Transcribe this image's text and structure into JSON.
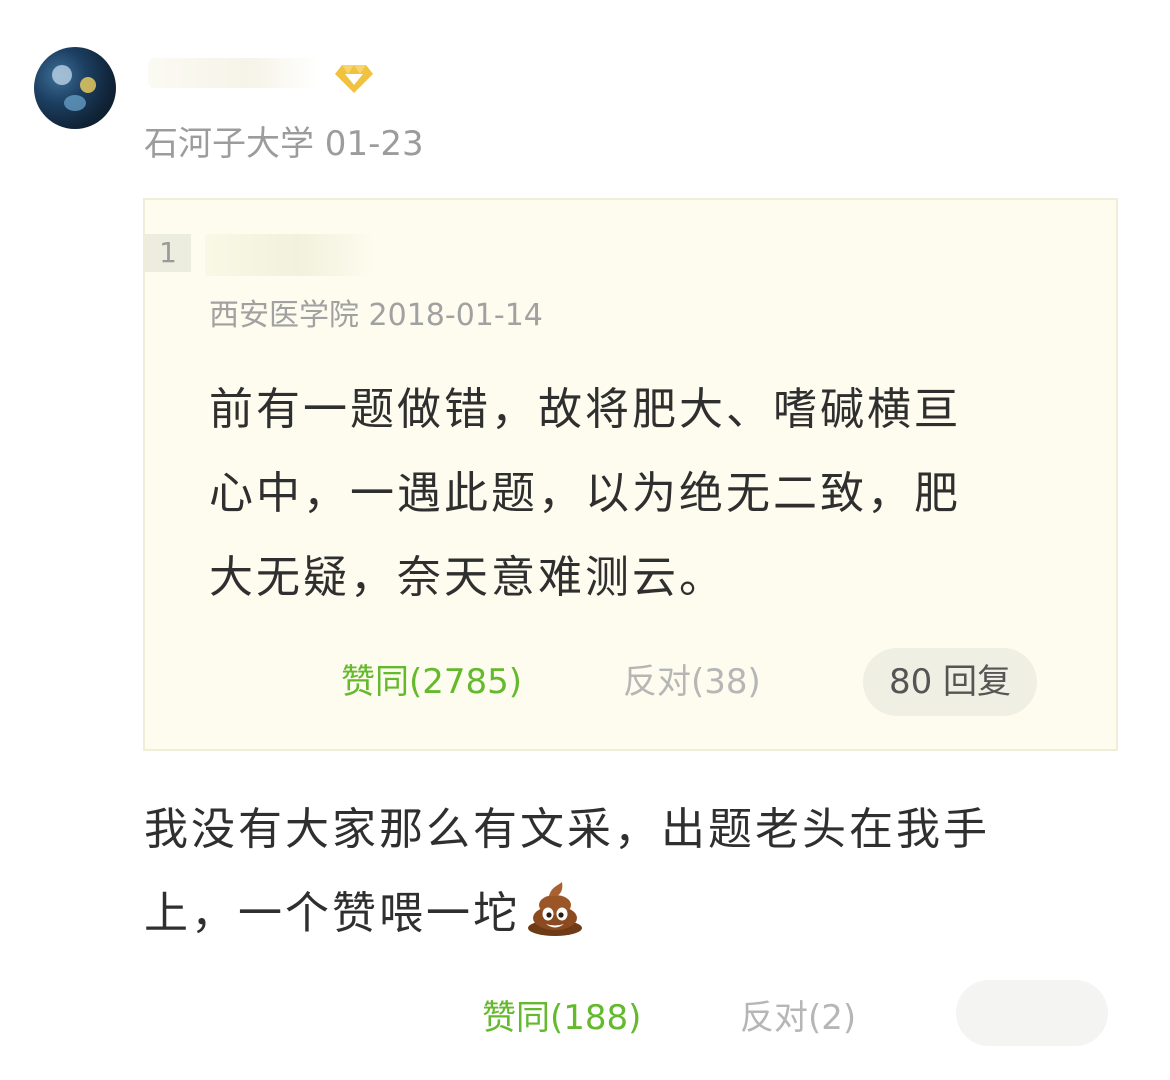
{
  "header": {
    "username": "",
    "meta": "石河子大学 01-23"
  },
  "quote": {
    "floor": "1",
    "username": "",
    "meta": "西安医学院 2018-01-14",
    "lines": [
      "前有一题做错，故将肥大、嗜碱横亘",
      "心中，一遇此题，以为绝无二致，肥",
      "大无疑，奈天意难测云。"
    ],
    "agree_label": "赞同(2785)",
    "oppose_label": "反对(38)",
    "reply_label": "80 回复"
  },
  "comment": {
    "lines": [
      "我没有大家那么有文采，出题老头在我手",
      "上，一个赞喂一坨"
    ],
    "emoji_name": "poop-icon",
    "agree_label": "赞同(188)",
    "oppose_label": "反对(2)"
  },
  "colors": {
    "accent_green": "#64b92c",
    "quote_background": "#fdfcee",
    "vip_gold": "#f1c23f"
  }
}
